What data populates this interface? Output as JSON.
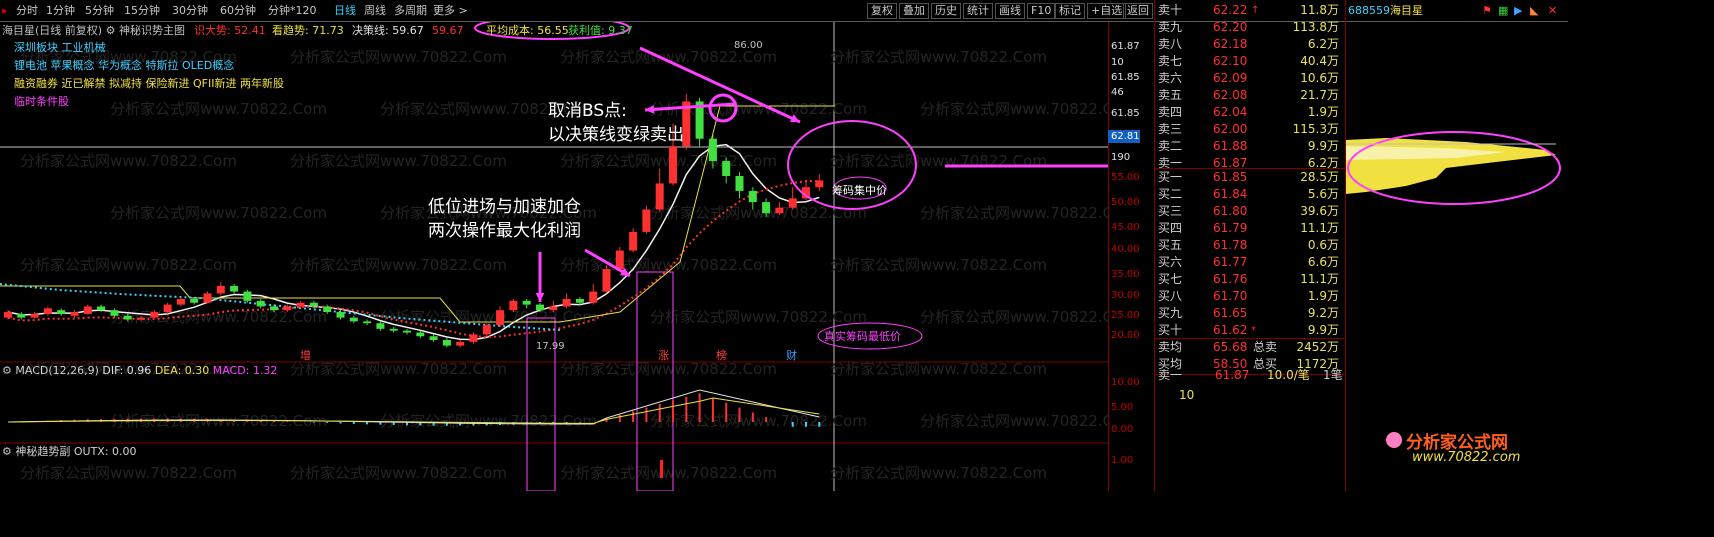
{
  "toolbar": {
    "periods": [
      "分时",
      "1分钟",
      "5分钟",
      "15分钟",
      "30分钟",
      "60分钟",
      "分钟*120",
      "日线",
      "周线",
      "多周期",
      "更多 >"
    ],
    "active": "日线",
    "actions": [
      "复权",
      "叠加",
      "历史",
      "统计",
      "画线",
      "F10",
      "标记",
      "+自选",
      "返回"
    ],
    "stock_code": "688559",
    "stock_name": "海目星"
  },
  "main_header": {
    "title": "海目星(日线 前复权)",
    "indicator_name": "神秘识势主图",
    "items": [
      {
        "label": "识大势: 52.41",
        "color": "#ff3030"
      },
      {
        "label": "看趋势: 71.73",
        "color": "#e8e040"
      },
      {
        "label": "决策线: 59.67",
        "color": "#e0e0e0"
      },
      {
        "label": "59.67",
        "color": "#ff3030"
      }
    ],
    "avg_cost": "平均成本: 56.55",
    "profit": "获利值: 9.37"
  },
  "concepts": [
    {
      "text": "深圳板块 工业机械",
      "color": "#40d0ff"
    },
    {
      "text": "锂电池 苹果概念 华为概念 特斯拉 OLED概念",
      "color": "#40d0ff"
    },
    {
      "text": "融资融券 近已解禁 拟减持 保险新进 QFII新进 两年新股",
      "color": "#f0e040"
    },
    {
      "text": "临时条件股",
      "color": "#ff40ff"
    }
  ],
  "watermark": "分析家公式网www.70822.Com",
  "annotations": {
    "cancel_bs": "取消BS点:",
    "cancel_bs_2": "以决策线变绿卖出",
    "entry": "低位进场与加速加仓",
    "entry_2": "两次操作最大化利润",
    "chip_focus": "筹码集中价",
    "lowest_chip": "真实筹码最低价"
  },
  "price_labels": {
    "high": "86.00",
    "low": "17.99",
    "current": "62.81"
  },
  "event_markers": [
    "增",
    "涨",
    "榜",
    "财"
  ],
  "macd": {
    "label": "MACD(12,26,9)",
    "dif": "DIF: 0.96",
    "dea": "DEA: 0.30",
    "macd": "MACD: 1.32"
  },
  "sub": {
    "label": "神秘趋势副",
    "outx": "OUTX: 0.00"
  },
  "axis_labels": {
    "main": [
      "61.87",
      "10",
      "61.85",
      "46",
      "61.85",
      "190",
      "55.00",
      "50.00",
      "45.00",
      "40.00",
      "35.00",
      "30.00",
      "25.00",
      "20.00"
    ],
    "macd": [
      "10.00",
      "5.00",
      "0.00"
    ],
    "sub": [
      "1.00"
    ]
  },
  "order_book": {
    "sells": [
      {
        "label": "卖十",
        "price": "62.22",
        "flag": "↑",
        "qty": "11.8万"
      },
      {
        "label": "卖九",
        "price": "62.20",
        "qty": "113.8万"
      },
      {
        "label": "卖八",
        "price": "62.18",
        "qty": "6.2万"
      },
      {
        "label": "卖七",
        "price": "62.10",
        "qty": "40.4万"
      },
      {
        "label": "卖六",
        "price": "62.09",
        "qty": "10.6万"
      },
      {
        "label": "卖五",
        "price": "62.08",
        "qty": "21.7万"
      },
      {
        "label": "卖四",
        "price": "62.04",
        "qty": "1.9万"
      },
      {
        "label": "卖三",
        "price": "62.00",
        "qty": "115.3万"
      },
      {
        "label": "卖二",
        "price": "61.88",
        "qty": "9.9万"
      },
      {
        "label": "卖一",
        "price": "61.87",
        "qty": "6.2万"
      }
    ],
    "buys": [
      {
        "label": "买一",
        "price": "61.85",
        "qty": "28.5万"
      },
      {
        "label": "买二",
        "price": "61.84",
        "qty": "5.6万"
      },
      {
        "label": "买三",
        "price": "61.80",
        "qty": "39.6万"
      },
      {
        "label": "买四",
        "price": "61.79",
        "qty": "11.1万"
      },
      {
        "label": "买五",
        "price": "61.78",
        "qty": "0.6万"
      },
      {
        "label": "买六",
        "price": "61.77",
        "qty": "6.6万"
      },
      {
        "label": "买七",
        "price": "61.76",
        "qty": "11.1万"
      },
      {
        "label": "买八",
        "price": "61.70",
        "qty": "1.9万"
      },
      {
        "label": "买九",
        "price": "61.65",
        "qty": "9.2万"
      },
      {
        "label": "买十",
        "price": "61.62",
        "flag": "*",
        "qty": "9.9万"
      }
    ],
    "summary": [
      {
        "k1": "卖均",
        "v1": "65.68",
        "k2": "总卖",
        "v2": "2452万"
      },
      {
        "k1": "买均",
        "v1": "58.50",
        "k2": "总买",
        "v2": "1172万"
      }
    ],
    "trade": {
      "label": "卖一",
      "price": "61.87",
      "vol": "10.0/笔",
      "count": "1笔",
      "extra": "10"
    }
  },
  "logo": {
    "title": "分析家公式网",
    "url": "www.70822.com"
  },
  "chart_data": {
    "type": "candlestick",
    "title": "海目星(日线 前复权)",
    "ylim": [
      17,
      87
    ],
    "high": 86.0,
    "low": 17.99,
    "last": 62.81,
    "candles": [
      [
        0,
        26.0,
        27.5,
        25.5,
        28.0
      ],
      [
        1,
        27.0,
        26.0,
        25.5,
        27.5
      ],
      [
        2,
        26.0,
        27.0,
        25.8,
        27.5
      ],
      [
        3,
        27.0,
        28.5,
        26.5,
        29.0
      ],
      [
        4,
        28.0,
        27.0,
        26.5,
        28.5
      ],
      [
        5,
        26.5,
        27.5,
        26.0,
        28.0
      ],
      [
        6,
        27.0,
        29.0,
        26.8,
        29.5
      ],
      [
        7,
        29.0,
        28.0,
        27.5,
        29.5
      ],
      [
        8,
        28.0,
        26.5,
        26.0,
        28.5
      ],
      [
        9,
        26.5,
        25.5,
        25.0,
        27.0
      ],
      [
        10,
        25.5,
        26.0,
        25.0,
        26.5
      ],
      [
        11,
        26.0,
        27.5,
        25.8,
        28.0
      ],
      [
        12,
        27.5,
        29.5,
        27.0,
        30.0
      ],
      [
        13,
        29.5,
        31.0,
        29.0,
        31.5
      ],
      [
        14,
        31.0,
        30.0,
        29.5,
        31.5
      ],
      [
        15,
        30.0,
        32.5,
        29.8,
        33.0
      ],
      [
        16,
        32.5,
        34.5,
        32.0,
        35.5
      ],
      [
        17,
        34.5,
        33.0,
        32.5,
        35.0
      ],
      [
        18,
        33.0,
        30.5,
        30.0,
        33.5
      ],
      [
        19,
        30.5,
        29.0,
        28.5,
        31.0
      ],
      [
        20,
        29.0,
        28.0,
        27.5,
        29.5
      ],
      [
        21,
        28.0,
        29.0,
        27.5,
        29.5
      ],
      [
        22,
        29.0,
        30.0,
        28.5,
        30.5
      ],
      [
        23,
        30.0,
        29.0,
        28.5,
        30.5
      ],
      [
        24,
        29.0,
        27.5,
        27.0,
        29.5
      ],
      [
        25,
        27.5,
        26.0,
        25.5,
        28.0
      ],
      [
        26,
        26.0,
        25.0,
        24.5,
        26.5
      ],
      [
        27,
        25.0,
        24.5,
        24.0,
        25.5
      ],
      [
        28,
        24.5,
        23.0,
        22.5,
        25.0
      ],
      [
        29,
        23.0,
        22.5,
        22.0,
        23.5
      ],
      [
        30,
        22.5,
        22.0,
        21.5,
        23.0
      ],
      [
        31,
        22.0,
        21.0,
        20.5,
        22.5
      ],
      [
        32,
        21.0,
        20.0,
        19.5,
        21.5
      ],
      [
        33,
        20.0,
        18.5,
        18.0,
        20.5
      ],
      [
        34,
        18.5,
        19.5,
        17.99,
        20.0
      ],
      [
        35,
        19.5,
        21.5,
        19.0,
        22.0
      ],
      [
        36,
        21.5,
        24.0,
        21.0,
        24.5
      ],
      [
        37,
        24.0,
        28.0,
        23.5,
        29.0
      ],
      [
        38,
        28.0,
        30.5,
        27.5,
        31.0
      ],
      [
        39,
        30.5,
        29.5,
        28.5,
        31.0
      ],
      [
        40,
        29.5,
        28.0,
        27.5,
        30.0
      ],
      [
        41,
        28.0,
        29.0,
        27.5,
        30.5
      ],
      [
        42,
        29.0,
        31.0,
        28.5,
        32.5
      ],
      [
        43,
        31.0,
        30.0,
        29.5,
        31.5
      ],
      [
        44,
        30.0,
        33.0,
        29.5,
        35.0
      ],
      [
        45,
        33.0,
        39.0,
        32.5,
        40.0
      ],
      [
        46,
        39.0,
        44.0,
        38.5,
        45.0
      ],
      [
        47,
        44.0,
        49.0,
        43.5,
        50.0
      ],
      [
        48,
        49.0,
        55.0,
        48.5,
        56.0
      ],
      [
        49,
        55.0,
        62.0,
        54.5,
        66.0
      ],
      [
        50,
        62.0,
        72.0,
        61.5,
        78.0
      ],
      [
        51,
        72.0,
        84.0,
        71.0,
        86.0
      ],
      [
        52,
        84.0,
        74.0,
        72.0,
        85.0
      ],
      [
        53,
        74.0,
        68.0,
        66.0,
        75.0
      ],
      [
        54,
        68.0,
        64.0,
        62.0,
        69.0
      ],
      [
        55,
        64.0,
        60.0,
        58.0,
        65.0
      ],
      [
        56,
        60.0,
        57.0,
        55.0,
        61.0
      ],
      [
        57,
        57.0,
        54.0,
        53.0,
        58.0
      ],
      [
        58,
        54.0,
        55.5,
        53.5,
        57.0
      ],
      [
        59,
        55.5,
        58.0,
        55.0,
        61.0
      ],
      [
        60,
        58.0,
        61.0,
        57.5,
        63.0
      ],
      [
        61,
        61.0,
        62.81,
        60.0,
        64.5
      ]
    ]
  }
}
